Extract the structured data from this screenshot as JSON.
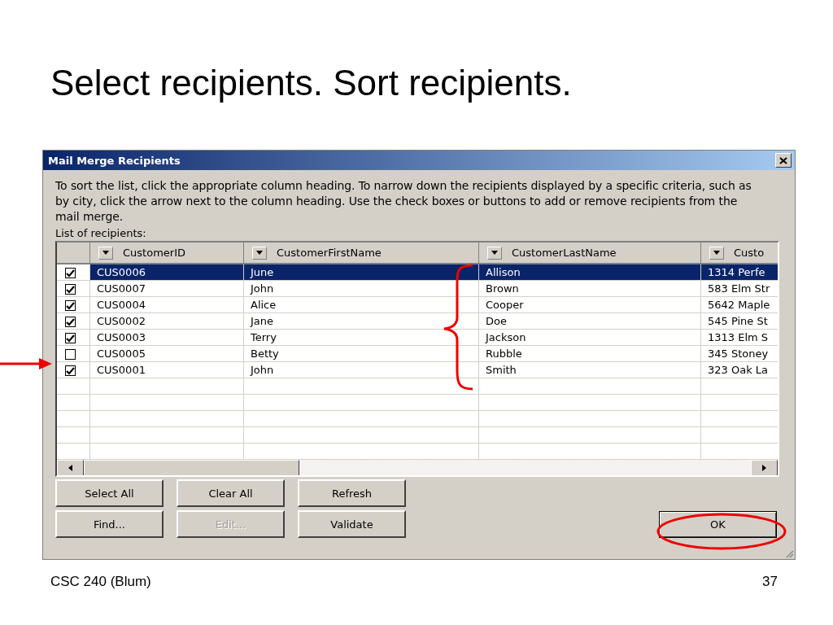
{
  "slide_title": "Select recipients. Sort recipients.",
  "dialog": {
    "title": "Mail Merge Recipients",
    "instructions": "To sort the list, click the appropriate column heading.  To narrow down the recipients displayed by a specific criteria, such as by city, click the arrow next to the column heading.  Use the check boxes or buttons to add or remove recipients from the mail merge.",
    "list_label": "List of recipients:",
    "columns": [
      "CustomerID",
      "CustomerFirstName",
      "CustomerLastName",
      "Custo"
    ],
    "rows": [
      {
        "checked": true,
        "selected": true,
        "cells": [
          "CUS0006",
          "June",
          "Allison",
          "1314 Perfe"
        ]
      },
      {
        "checked": true,
        "selected": false,
        "cells": [
          "CUS0007",
          "John",
          "Brown",
          "583 Elm Str"
        ]
      },
      {
        "checked": true,
        "selected": false,
        "cells": [
          "CUS0004",
          "Alice",
          "Cooper",
          "5642 Maple"
        ]
      },
      {
        "checked": true,
        "selected": false,
        "cells": [
          "CUS0002",
          "Jane",
          "Doe",
          "545 Pine St"
        ]
      },
      {
        "checked": true,
        "selected": false,
        "cells": [
          "CUS0003",
          "Terry",
          "Jackson",
          "1313 Elm S"
        ]
      },
      {
        "checked": false,
        "selected": false,
        "cells": [
          "CUS0005",
          "Betty",
          "Rubble",
          "345 Stoney"
        ]
      },
      {
        "checked": true,
        "selected": false,
        "cells": [
          "CUS0001",
          "John",
          "Smith",
          "323 Oak La"
        ]
      }
    ],
    "buttons": [
      {
        "label": "Select All",
        "disabled": false
      },
      {
        "label": "Clear All",
        "disabled": false
      },
      {
        "label": "Refresh",
        "disabled": false
      },
      {
        "label": "Find...",
        "disabled": false
      },
      {
        "label": "Edit...",
        "disabled": true
      },
      {
        "label": "Validate",
        "disabled": false
      }
    ],
    "ok_button": {
      "label": "OK"
    }
  },
  "footer": {
    "course": "CSC 240 (Blum)",
    "page": "37"
  }
}
